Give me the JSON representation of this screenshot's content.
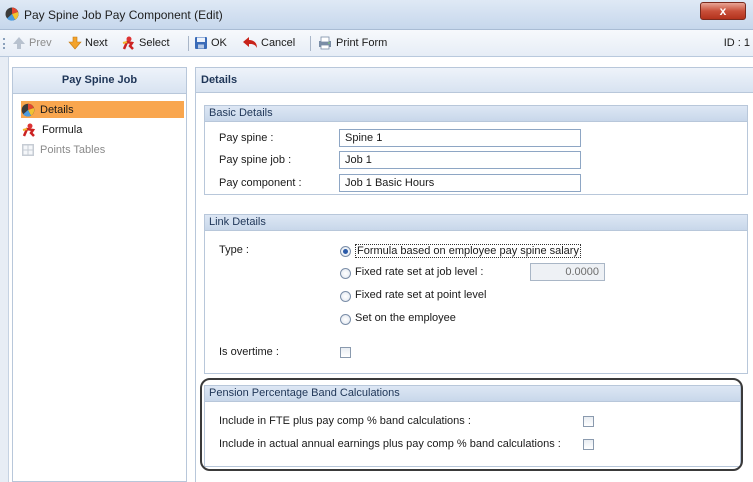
{
  "window": {
    "title": "Pay Spine Job Pay Component (Edit)",
    "close_label": "x"
  },
  "toolbar": {
    "prev": "Prev",
    "next": "Next",
    "select": "Select",
    "ok": "OK",
    "cancel": "Cancel",
    "print_form": "Print Form",
    "id_label": "ID : 1"
  },
  "sidebar": {
    "header": "Pay Spine Job",
    "items": [
      {
        "label": "Details",
        "icon": "details-icon",
        "selected": true
      },
      {
        "label": "Formula",
        "icon": "formula-icon",
        "selected": false
      },
      {
        "label": "Points Tables",
        "icon": "points-tables-icon",
        "selected": false,
        "disabled": true
      }
    ]
  },
  "main": {
    "header": "Details",
    "basic_details": {
      "title": "Basic Details",
      "pay_spine_label": "Pay spine :",
      "pay_spine_value": "Spine 1",
      "pay_spine_job_label": "Pay spine job :",
      "pay_spine_job_value": "Job 1",
      "pay_component_label": "Pay component :",
      "pay_component_value": "Job 1 Basic Hours"
    },
    "link_details": {
      "title": "Link Details",
      "type_label": "Type :",
      "options": [
        "Formula based on employee pay spine salary",
        "Fixed rate set at job level :",
        "Fixed rate set at point level",
        "Set on the employee"
      ],
      "selected_option": 0,
      "fixed_rate_value": "0.0000",
      "is_overtime_label": "Is overtime :",
      "is_overtime_checked": false
    },
    "pension": {
      "title": "Pension Percentage Band Calculations",
      "fte_label": "Include in FTE plus pay comp % band calculations :",
      "fte_checked": false,
      "actual_label": "Include in actual annual earnings plus pay comp % band calculations :",
      "actual_checked": false
    }
  },
  "colors": {
    "selected_nav": "#f9a64e",
    "header_text": "#1e3557",
    "radio_dot": "#2a5aa8"
  }
}
